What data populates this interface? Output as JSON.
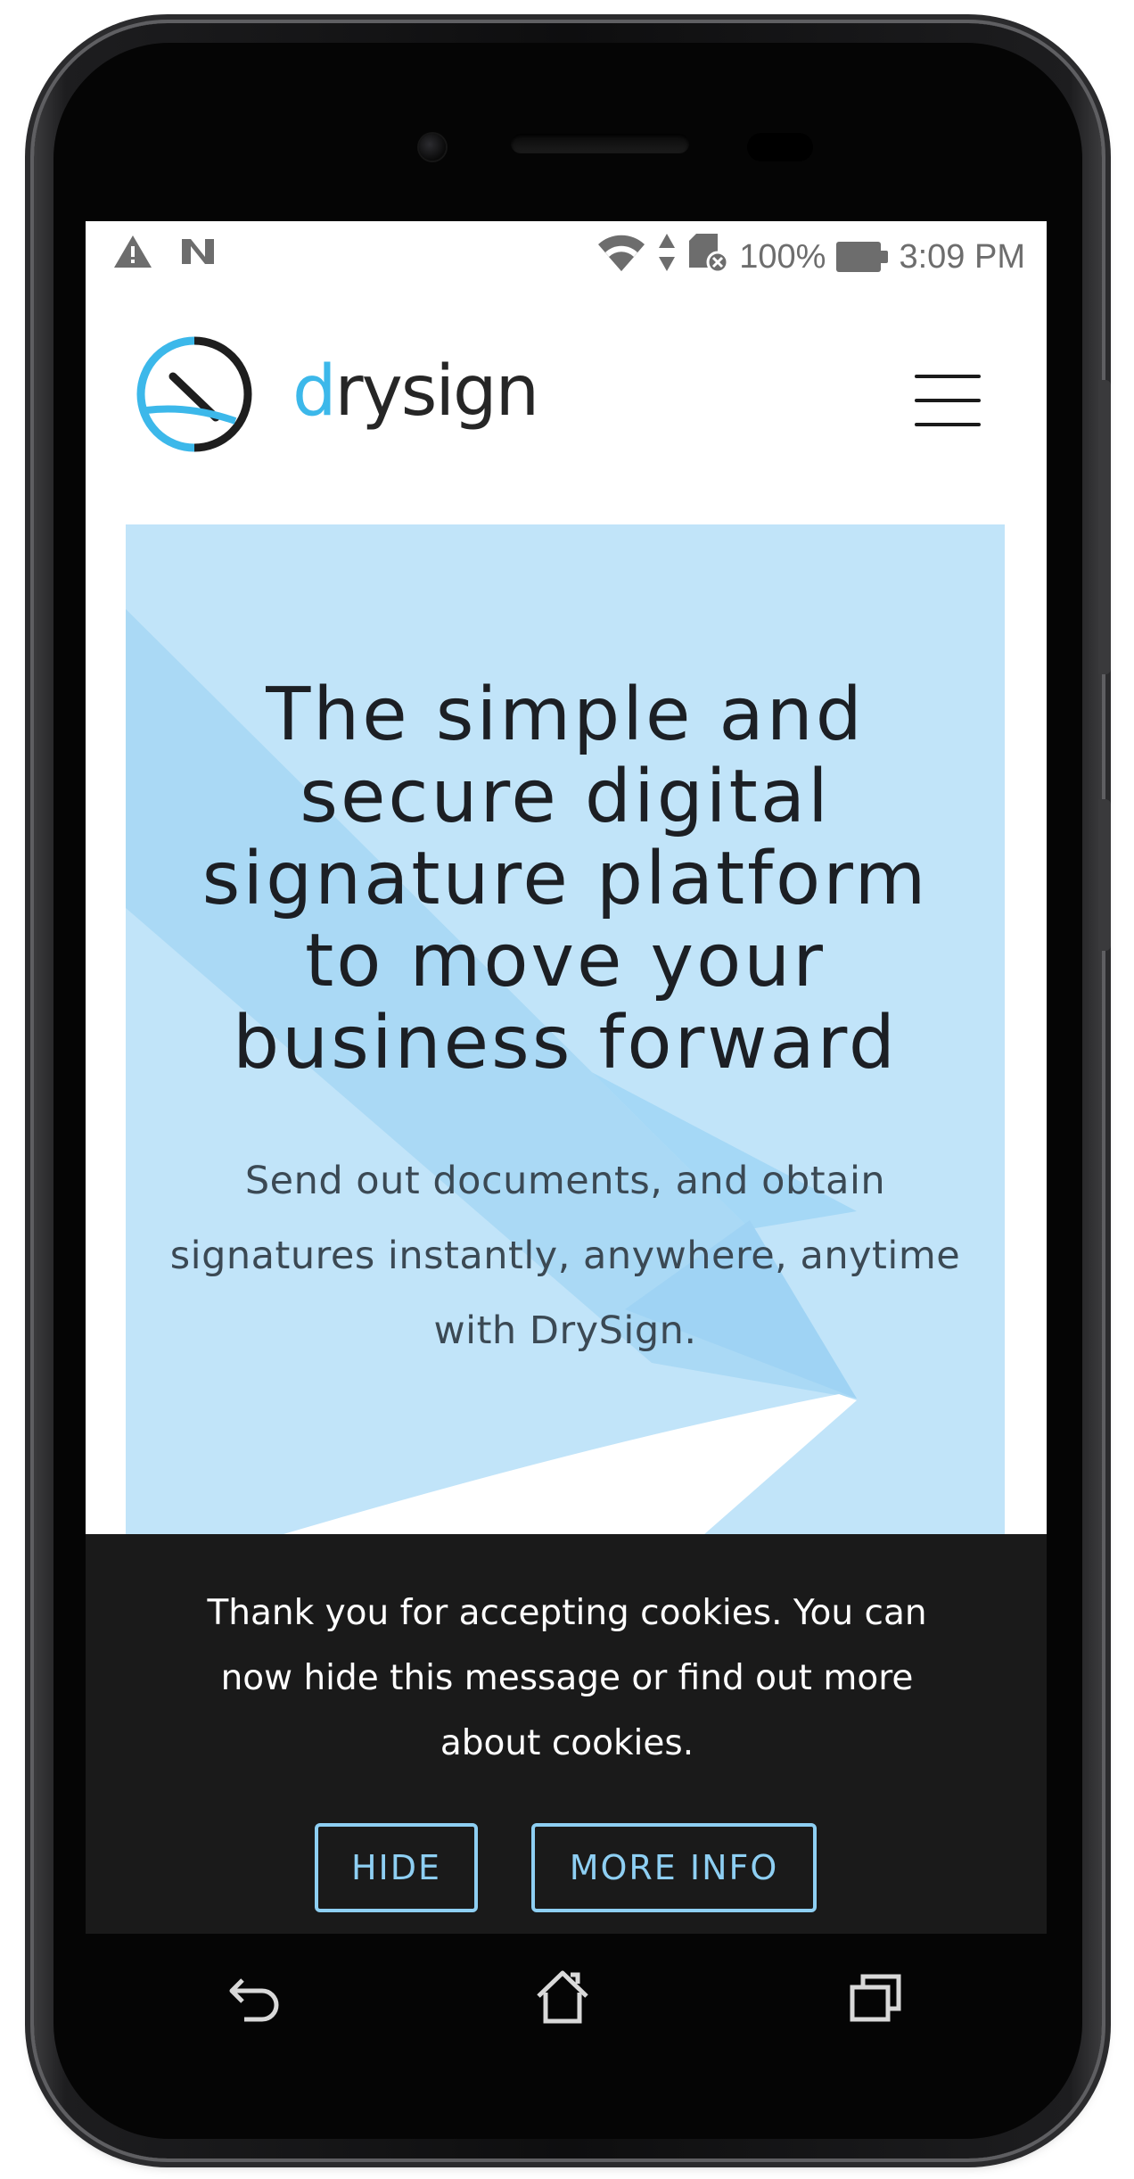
{
  "statusbar": {
    "battery_percent": "100%",
    "time": "3:09 PM",
    "icons": [
      "warning-icon",
      "nfc-icon",
      "wifi-icon",
      "data-arrows-icon",
      "sd-card-icon",
      "battery-icon"
    ]
  },
  "header": {
    "logo_d": "d",
    "logo_rest": "rysign",
    "menu_icon": "hamburger-menu-icon"
  },
  "hero": {
    "title_lines": [
      "The simple and",
      "secure digital",
      "signature platform",
      "to move your",
      "business forward"
    ],
    "subtitle_lines": [
      "Send out documents, and obtain",
      "signatures instantly, anywhere, anytime",
      "with DrySign."
    ]
  },
  "cookie_banner": {
    "text_lines": [
      "Thank you for accepting cookies. You can",
      "now hide this message or find out more",
      "about cookies."
    ],
    "hide_label": "HIDE",
    "more_info_label": "MORE INFO"
  },
  "colors": {
    "brand_blue": "#3cb8ea",
    "hero_bg": "#c1e4f9",
    "banner_bg": "#1a1a1a",
    "button_outline": "#8ecff3"
  },
  "system_nav": [
    "back-icon",
    "home-icon",
    "recents-icon"
  ]
}
